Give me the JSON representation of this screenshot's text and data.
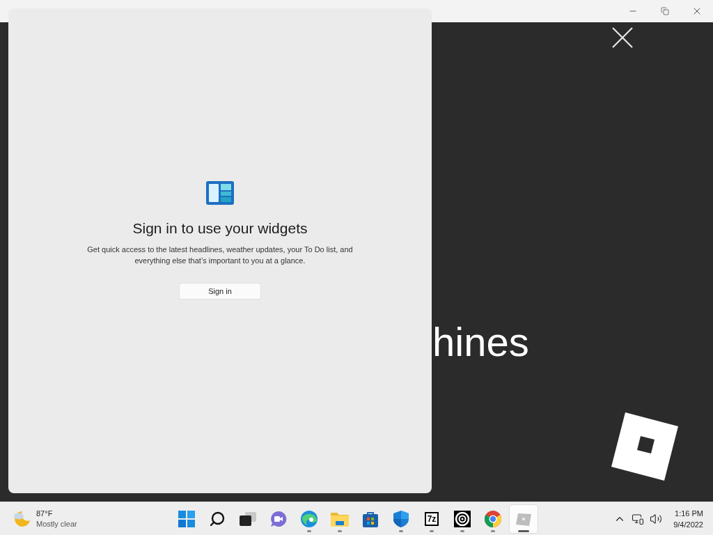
{
  "app_window": {
    "content_text": "hines"
  },
  "widgets_panel": {
    "heading": "Sign in to use your widgets",
    "description": "Get quick access to the latest headlines, weather updates, your To Do list, and everything else that’s important to you at a glance.",
    "button": "Sign in"
  },
  "taskbar": {
    "weather": {
      "temperature": "87°F",
      "condition": "Mostly clear"
    },
    "apps": [
      {
        "kind": "start",
        "running": false,
        "active": false
      },
      {
        "kind": "search",
        "running": false,
        "active": false
      },
      {
        "kind": "taskview",
        "running": false,
        "active": false
      },
      {
        "kind": "chat",
        "running": false,
        "active": false
      },
      {
        "kind": "edge",
        "running": true,
        "active": false
      },
      {
        "kind": "explorer",
        "running": true,
        "active": false
      },
      {
        "kind": "store",
        "running": false,
        "active": false
      },
      {
        "kind": "defender",
        "running": true,
        "active": false
      },
      {
        "kind": "archiver",
        "label": "7z",
        "running": true,
        "active": false
      },
      {
        "kind": "target",
        "running": true,
        "active": false
      },
      {
        "kind": "chrome",
        "running": true,
        "active": false
      },
      {
        "kind": "roblox",
        "running": true,
        "active": true
      }
    ],
    "tray": {
      "time": "1:16 PM",
      "date": "9/4/2022"
    }
  }
}
